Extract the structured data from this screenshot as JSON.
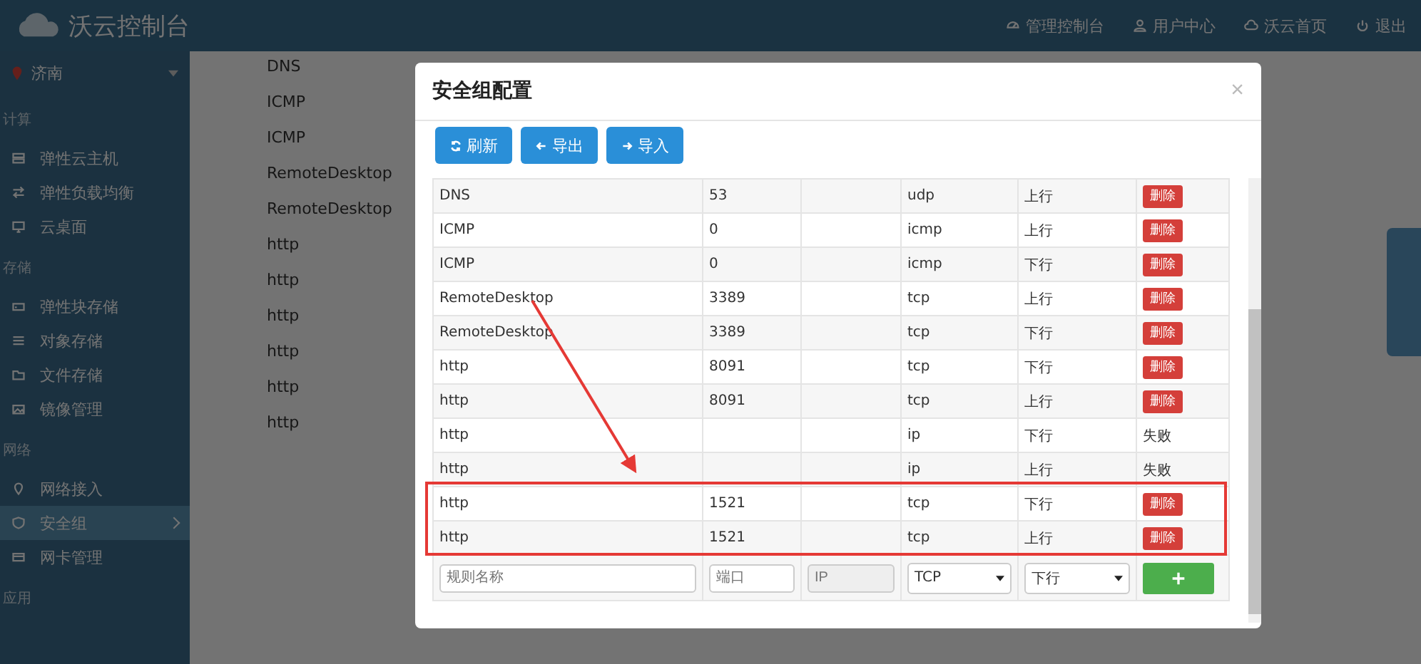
{
  "topbar": {
    "brand": "沃云控制台",
    "links": [
      {
        "label": "管理控制台"
      },
      {
        "label": "用户中心"
      },
      {
        "label": "沃云首页"
      },
      {
        "label": "退出"
      }
    ]
  },
  "sidebar": {
    "region": "济南",
    "groups": [
      {
        "label": "计算",
        "items": [
          {
            "label": "弹性云主机",
            "selected": false
          },
          {
            "label": "弹性负载均衡",
            "selected": false
          },
          {
            "label": "云桌面",
            "selected": false
          }
        ]
      },
      {
        "label": "存储",
        "items": [
          {
            "label": "弹性块存储",
            "selected": false
          },
          {
            "label": "对象存储",
            "selected": false
          },
          {
            "label": "文件存储",
            "selected": false
          },
          {
            "label": "镜像管理",
            "selected": false
          }
        ]
      },
      {
        "label": "网络",
        "items": [
          {
            "label": "网络接入",
            "selected": false
          },
          {
            "label": "安全组",
            "selected": true
          },
          {
            "label": "网卡管理",
            "selected": false
          }
        ]
      },
      {
        "label": "应用"
      }
    ]
  },
  "background_rows": [
    "DNS",
    "ICMP",
    "ICMP",
    "RemoteDesktop",
    "RemoteDesktop",
    "http",
    "http",
    "http",
    "http",
    "http",
    "http"
  ],
  "modal": {
    "title": "安全组配置",
    "close": "×",
    "toolbar": [
      {
        "label": "刷新"
      },
      {
        "label": "导出"
      },
      {
        "label": "导入"
      }
    ],
    "rows": [
      {
        "name": "DNS",
        "port": "53",
        "protocol": "udp",
        "direction": "上行",
        "action": {
          "kind": "button",
          "label": "删除"
        }
      },
      {
        "name": "ICMP",
        "port": "0",
        "protocol": "icmp",
        "direction": "上行",
        "action": {
          "kind": "button",
          "label": "删除"
        }
      },
      {
        "name": "ICMP",
        "port": "0",
        "protocol": "icmp",
        "direction": "下行",
        "action": {
          "kind": "button",
          "label": "删除"
        }
      },
      {
        "name": "RemoteDesktop",
        "port": "3389",
        "protocol": "tcp",
        "direction": "上行",
        "action": {
          "kind": "button",
          "label": "删除"
        }
      },
      {
        "name": "RemoteDesktop",
        "port": "3389",
        "protocol": "tcp",
        "direction": "下行",
        "action": {
          "kind": "button",
          "label": "删除"
        }
      },
      {
        "name": "http",
        "port": "8091",
        "protocol": "tcp",
        "direction": "下行",
        "action": {
          "kind": "button",
          "label": "删除"
        }
      },
      {
        "name": "http",
        "port": "8091",
        "protocol": "tcp",
        "direction": "上行",
        "action": {
          "kind": "button",
          "label": "删除"
        }
      },
      {
        "name": "http",
        "protocol": "ip",
        "direction": "下行",
        "action": {
          "kind": "text",
          "label": "失败"
        }
      },
      {
        "name": "http",
        "protocol": "ip",
        "direction": "上行",
        "action": {
          "kind": "text",
          "label": "失败"
        }
      }
    ],
    "framed_rows": [
      {
        "name": "http",
        "port": "1521",
        "protocol": "tcp",
        "direction": "下行",
        "action": {
          "kind": "button",
          "label": "删除"
        }
      },
      {
        "name": "http",
        "port": "1521",
        "protocol": "tcp",
        "direction": "上行",
        "action": {
          "kind": "button",
          "label": "删除"
        }
      }
    ],
    "form": {
      "name_placeholder": "规则名称",
      "port_placeholder": "端口",
      "ip_placeholder": "IP",
      "ip_disabled": true,
      "protocol": "TCP",
      "direction": "下行"
    }
  }
}
